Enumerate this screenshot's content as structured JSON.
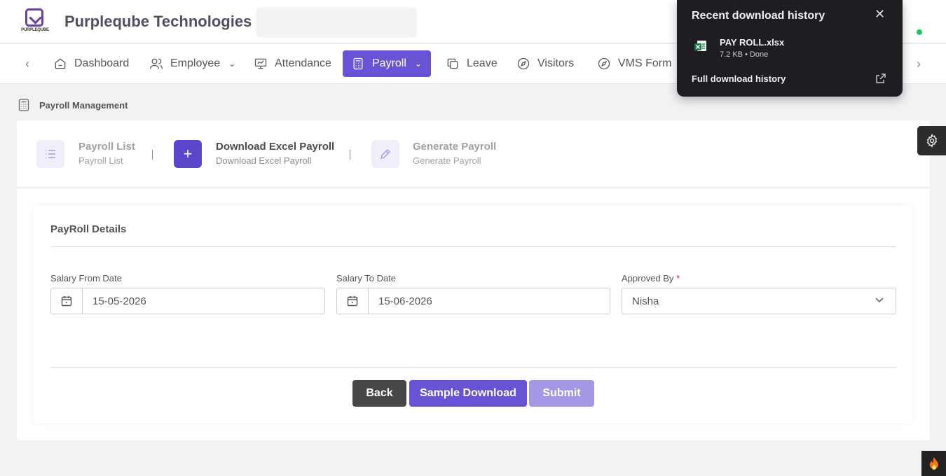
{
  "header": {
    "logo_text": "PURPLEQUBE",
    "company_name": "Purpleqube Technologies"
  },
  "nav": {
    "items": [
      {
        "label": "Dashboard",
        "icon": "home-icon"
      },
      {
        "label": "Employee",
        "icon": "users-icon"
      },
      {
        "label": "Attendance",
        "icon": "presentation-chart-icon"
      },
      {
        "label": "Payroll",
        "icon": "calculator-icon",
        "active": true
      },
      {
        "label": "Leave",
        "icon": "copy-icon"
      },
      {
        "label": "Visitors",
        "icon": "compass-icon"
      },
      {
        "label": "VMS Form",
        "icon": "compass-icon"
      }
    ]
  },
  "breadcrumb": {
    "label": "Payroll Management",
    "icon": "calculator-icon"
  },
  "steps": [
    {
      "title": "Payroll List",
      "subtitle": "Payroll List",
      "icon": "list-icon"
    },
    {
      "title": "Download Excel Payroll",
      "subtitle": "Download Excel Payroll",
      "icon": "plus-icon"
    },
    {
      "title": "Generate Payroll",
      "subtitle": "Generate Payroll",
      "icon": "pencil-icon"
    }
  ],
  "form": {
    "title": "PayRoll Details",
    "salary_from": {
      "label": "Salary From Date",
      "value": "15-05-2026"
    },
    "salary_to": {
      "label": "Salary To Date",
      "value": "15-06-2026"
    },
    "approved_by": {
      "label": "Approved By",
      "required_mark": "*",
      "value": "Nisha"
    },
    "buttons": {
      "back": "Back",
      "sample": "Sample Download",
      "submit": "Submit"
    }
  },
  "download_popup": {
    "title": "Recent download history",
    "close": "✕",
    "file_name": "PAY ROLL.xlsx",
    "file_meta": "7.2 KB • Done",
    "full_history": "Full download history"
  },
  "colors": {
    "primary": "#6a52d4",
    "primary_light": "#a398e6",
    "dark_button": "#474747",
    "popup_bg": "#1f1d21"
  }
}
